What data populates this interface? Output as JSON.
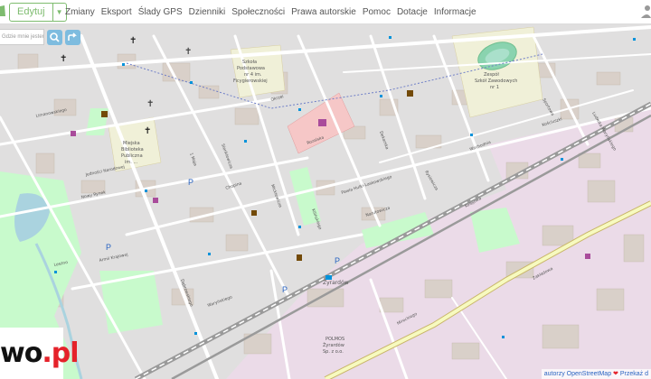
{
  "header": {
    "edit_label": "Edytuj",
    "nav": [
      "Zmiany",
      "Eksport",
      "Ślady GPS",
      "Dzienniki",
      "Społeczności",
      "Prawa autorskie",
      "Pomoc",
      "Dotacje",
      "Informacje"
    ]
  },
  "search": {
    "placeholder": "Gdzie mnie jestem?"
  },
  "map": {
    "labels": {
      "school1": [
        "Szkoła",
        "Podstawowa",
        "nr 4 im.",
        "Ficygierowskiej"
      ],
      "school2": [
        "Zespół",
        "Szkół Zawodowych",
        "nr 1"
      ],
      "library": [
        "Miejska",
        "Biblioteka",
        "Publiczna",
        "im. ..."
      ],
      "station": "Żyrardów",
      "polmos": [
        "POLMOS",
        "Żyrardów",
        "Sp. z o.o."
      ],
      "streets": [
        "Okrzei",
        "Wschodnia",
        "Mickiewicza",
        "Rozalska",
        "Sienkiewicza",
        "Kilińskiego",
        "Dekarska",
        "Pawla Hulki-Laskowskiego",
        "Narutowicza",
        "Kościuszki",
        "Waryńskiego",
        "Mireckiego",
        "Kolejowa",
        "Zakładowa",
        "1 Maja",
        "Sportowa",
        "Jedności Narodowej",
        "Limanowskiego",
        "Nowy Rynek",
        "Ludwika Waryńskiego",
        "Armii Krajowej",
        "Dąbrowskiego",
        "Chopina",
        "Leszno",
        "Rysiewicza"
      ]
    }
  },
  "logo": {
    "text": "wo",
    "suffix": ".pl"
  },
  "attribution": {
    "link1": "autorzy OpenStreetMap",
    "heart": "❤",
    "link2": "Przekaż d"
  },
  "colors": {
    "accent": "#7ebc6f",
    "residential": "#e0dfdf",
    "building": "#d9d0c9",
    "park": "#c8facc",
    "railway": "#999999",
    "industrial": "#ebdbe8"
  }
}
